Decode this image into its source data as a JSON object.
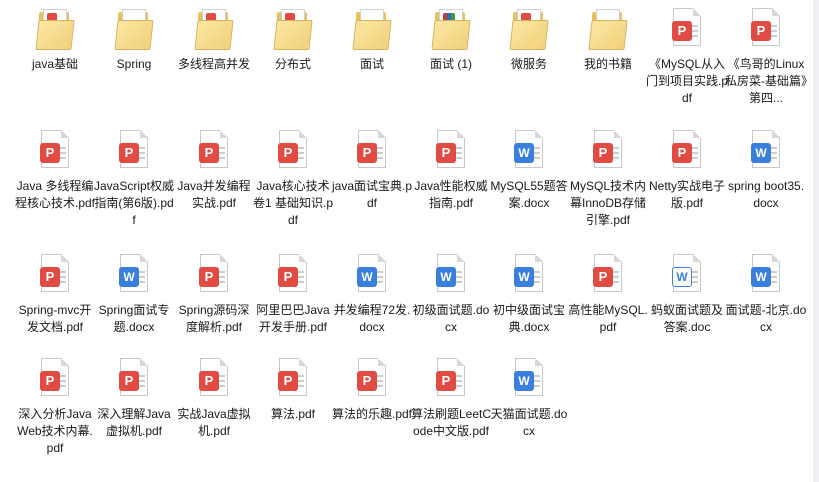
{
  "window": {
    "scrollbar": true
  },
  "colors": {
    "pdf": "#e04c44",
    "word": "#3a7fdc",
    "folder": "#f1d17a"
  },
  "items": [
    {
      "label": "java基础",
      "type": "folder",
      "mini": "pdf"
    },
    {
      "label": "Spring",
      "type": "folder",
      "mini": "none"
    },
    {
      "label": "多线程高并发",
      "type": "folder",
      "mini": "pdf"
    },
    {
      "label": "分布式",
      "type": "folder",
      "mini": "pdf"
    },
    {
      "label": "面试",
      "type": "folder",
      "mini": "none"
    },
    {
      "label": "面试 (1)",
      "type": "folder",
      "mini": "books"
    },
    {
      "label": "微服务",
      "type": "folder",
      "mini": "pdf"
    },
    {
      "label": "我的书籍",
      "type": "folder",
      "mini": "none"
    },
    {
      "label": "《MySQL从入门到项目实践.pdf",
      "type": "pdf"
    },
    {
      "label": "《鸟哥的Linux私房菜-基础篇》第四...",
      "type": "pdf"
    },
    {
      "label": "Java 多线程编程核心技术.pdf",
      "type": "pdf"
    },
    {
      "label": "JavaScript权威指南(第6版).pdf",
      "type": "pdf"
    },
    {
      "label": "Java并发编程实战.pdf",
      "type": "pdf"
    },
    {
      "label": "Java核心技术 卷1 基础知识.pdf",
      "type": "pdf"
    },
    {
      "label": "java面试宝典.pdf",
      "type": "pdf"
    },
    {
      "label": "Java性能权威指南.pdf",
      "type": "pdf"
    },
    {
      "label": "MySQL55题答案.docx",
      "type": "word"
    },
    {
      "label": "MySQL技术内幕InnoDB存储引擎.pdf",
      "type": "pdf"
    },
    {
      "label": "Netty实战电子版.pdf",
      "type": "pdf"
    },
    {
      "label": "spring boot35.docx",
      "type": "word"
    },
    {
      "label": "Spring-mvc开发文档.pdf",
      "type": "pdf"
    },
    {
      "label": "Spring面试专题.docx",
      "type": "word"
    },
    {
      "label": "Spring源码深度解析.pdf",
      "type": "pdf"
    },
    {
      "label": "阿里巴巴Java开发手册.pdf",
      "type": "pdf"
    },
    {
      "label": "并发编程72发.docx",
      "type": "word"
    },
    {
      "label": "初级面试题.docx",
      "type": "word"
    },
    {
      "label": "初中级面试宝典.docx",
      "type": "word"
    },
    {
      "label": "高性能MySQL.pdf",
      "type": "pdf"
    },
    {
      "label": "蚂蚁面试题及答案.doc",
      "type": "wordlite"
    },
    {
      "label": "面试题-北京.docx",
      "type": "word"
    },
    {
      "label": "深入分析Java Web技术内幕.pdf",
      "type": "pdf"
    },
    {
      "label": "深入理解Java虚拟机.pdf",
      "type": "pdf"
    },
    {
      "label": "实战Java虚拟机.pdf",
      "type": "pdf"
    },
    {
      "label": "算法.pdf",
      "type": "pdf"
    },
    {
      "label": "算法的乐趣.pdf",
      "type": "pdf"
    },
    {
      "label": "算法刷题LeetCode中文版.pdf",
      "type": "pdf"
    },
    {
      "label": "天猫面试题.docx",
      "type": "word"
    }
  ]
}
